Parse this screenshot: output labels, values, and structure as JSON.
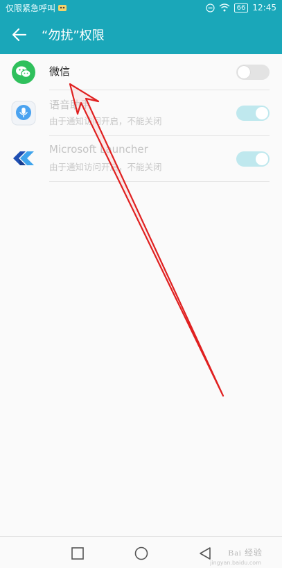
{
  "status_bar": {
    "left_text": "仅限紧急呼叫",
    "battery": "66",
    "time": "12:45"
  },
  "header": {
    "title": "“勿扰”权限"
  },
  "apps": [
    {
      "name": "微信",
      "subtitle": "",
      "enabled": true,
      "toggle_on": false
    },
    {
      "name": "语音助手",
      "subtitle": "由于通知访问开启，不能关闭",
      "enabled": false,
      "toggle_on": true
    },
    {
      "name": "Microsoft Launcher",
      "subtitle": "由于通知访问开启，不能关闭",
      "enabled": false,
      "toggle_on": true
    }
  ],
  "icons": {
    "back": "arrow-left-icon",
    "wechat": "wechat-icon",
    "voice_assistant": "microphone-icon",
    "launcher": "microsoft-launcher-icon",
    "nav_recents": "square-icon",
    "nav_home": "circle-icon",
    "nav_back": "triangle-back-icon"
  },
  "colors": {
    "accent": "#1aa7b9",
    "toggle_off": "#e3e3e3",
    "toggle_on_disabled": "#bfe8ee",
    "annotation_arrow": "#e02020"
  },
  "watermark": {
    "text": "Bai 经验",
    "url": "jingyan.baidu.com"
  }
}
